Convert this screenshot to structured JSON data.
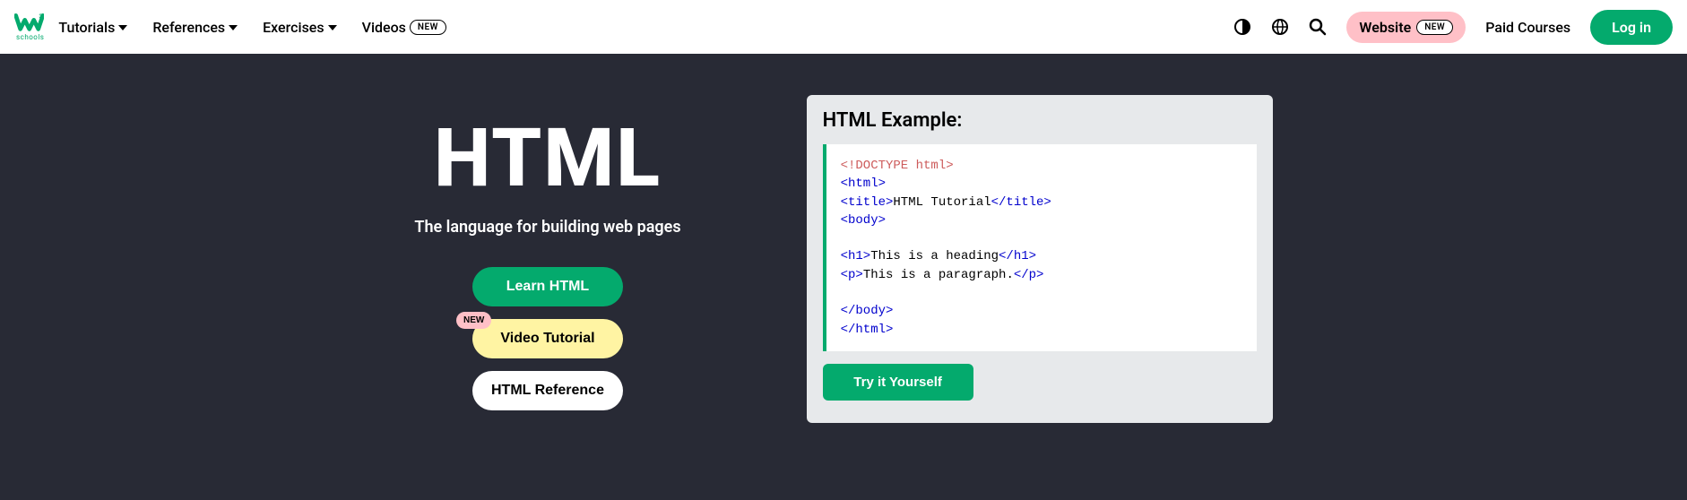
{
  "logo": {
    "sub": "schools"
  },
  "nav": {
    "tutorials": "Tutorials",
    "references": "References",
    "exercises": "Exercises",
    "videos": "Videos",
    "new_badge": "NEW"
  },
  "topright": {
    "website": "Website",
    "website_badge": "NEW",
    "paid": "Paid Courses",
    "login": "Log in"
  },
  "hero": {
    "title": "HTML",
    "subtitle": "The language for building web pages",
    "learn_btn": "Learn HTML",
    "video_btn": "Video Tutorial",
    "video_badge": "NEW",
    "ref_btn": "HTML Reference"
  },
  "example": {
    "title": "HTML Example:",
    "try_btn": "Try it Yourself",
    "code": {
      "l1a": "<!DOCTYPE",
      "l1b": " html",
      "l1c": ">",
      "l2": "<html>",
      "l3a": "<title>",
      "l3b": "HTML Tutorial",
      "l3c": "</title>",
      "l4": "<body>",
      "l6a": "<h1>",
      "l6b": "This is a heading",
      "l6c": "</h1>",
      "l7a": "<p>",
      "l7b": "This is a paragraph.",
      "l7c": "</p>",
      "l9": "</body>",
      "l10": "</html>"
    }
  }
}
